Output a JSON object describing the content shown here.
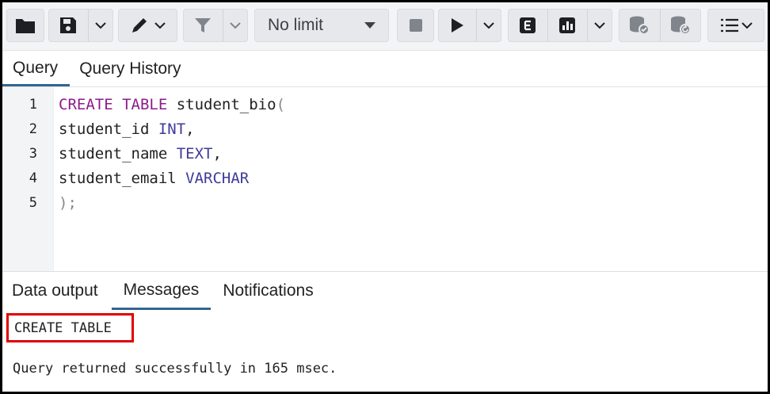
{
  "toolbar": {
    "buttons": [
      {
        "name": "open-file",
        "icon": "folder-icon"
      },
      {
        "name": "save",
        "icon": "save-icon",
        "dropdown": true
      },
      {
        "name": "edit",
        "icon": "pen-icon",
        "dropdown": true
      },
      {
        "name": "filter",
        "icon": "filter-icon",
        "dropdown": true
      },
      {
        "name": "stop",
        "icon": "stop-icon"
      },
      {
        "name": "execute",
        "icon": "play-icon",
        "dropdown": true
      },
      {
        "name": "explain",
        "icon": "explain-icon"
      },
      {
        "name": "explain-analyze",
        "icon": "chart-icon",
        "dropdown": true
      },
      {
        "name": "commit",
        "icon": "db-commit-icon"
      },
      {
        "name": "rollback",
        "icon": "db-rollback-icon"
      },
      {
        "name": "macros",
        "icon": "list-icon",
        "dropdown": true
      }
    ],
    "limit_select": {
      "value": "No limit"
    }
  },
  "editor_tabs": [
    "Query",
    "Query History"
  ],
  "editor": {
    "line_numbers": [
      "1",
      "2",
      "3",
      "4",
      "5"
    ],
    "lines": [
      [
        {
          "t": "CREATE TABLE",
          "c": "kw"
        },
        {
          "t": " student_bio",
          "c": ""
        },
        {
          "t": "(",
          "c": "pn"
        }
      ],
      [
        {
          "t": "student_id ",
          "c": ""
        },
        {
          "t": "INT",
          "c": "ty"
        },
        {
          "t": ",",
          "c": ""
        }
      ],
      [
        {
          "t": "student_name ",
          "c": ""
        },
        {
          "t": "TEXT",
          "c": "ty"
        },
        {
          "t": ",",
          "c": ""
        }
      ],
      [
        {
          "t": "student_email ",
          "c": ""
        },
        {
          "t": "VARCHAR",
          "c": "ty"
        }
      ],
      [
        {
          "t": ");",
          "c": "pn"
        }
      ]
    ]
  },
  "output_tabs": [
    "Data output",
    "Messages",
    "Notifications"
  ],
  "messages": {
    "line1": "CREATE TABLE",
    "line2": "Query returned successfully in 165 msec."
  },
  "colors": {
    "keyword": "#8d1d8a",
    "type": "#3e3b9b",
    "highlight": "#e00000",
    "active_tab": "#326690"
  }
}
